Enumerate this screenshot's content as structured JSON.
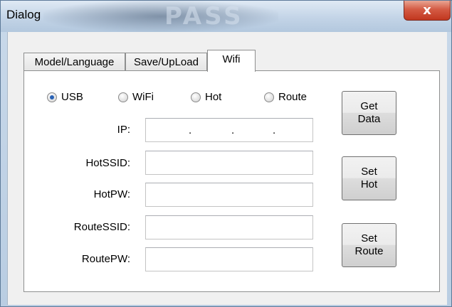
{
  "window": {
    "title": "Dialog",
    "title_watermark": "PASS",
    "close_glyph": "x"
  },
  "tabs": [
    {
      "label": "Model/Language",
      "active": false
    },
    {
      "label": "Save/UpLoad",
      "active": false
    },
    {
      "label": "Wifi",
      "active": true
    }
  ],
  "radios": [
    {
      "label": "USB",
      "checked": true
    },
    {
      "label": "WiFi",
      "checked": false
    },
    {
      "label": "Hot",
      "checked": false
    },
    {
      "label": "Route",
      "checked": false
    }
  ],
  "fields": {
    "ip": {
      "label": "IP:",
      "value": "",
      "separator": "."
    },
    "hot_ssid": {
      "label": "HotSSID:",
      "value": ""
    },
    "hot_pw": {
      "label": "HotPW:",
      "value": ""
    },
    "route_ssid": {
      "label": "RouteSSID:",
      "value": ""
    },
    "route_pw": {
      "label": "RoutePW:",
      "value": ""
    }
  },
  "buttons": {
    "get_data": {
      "line1": "Get",
      "line2": "Data"
    },
    "set_hot": {
      "line1": "Set",
      "line2": "Hot"
    },
    "set_route": {
      "line1": "Set",
      "line2": "Route"
    }
  },
  "colors": {
    "close_red": "#c1371f",
    "radio_selected": "#2a62b5"
  }
}
